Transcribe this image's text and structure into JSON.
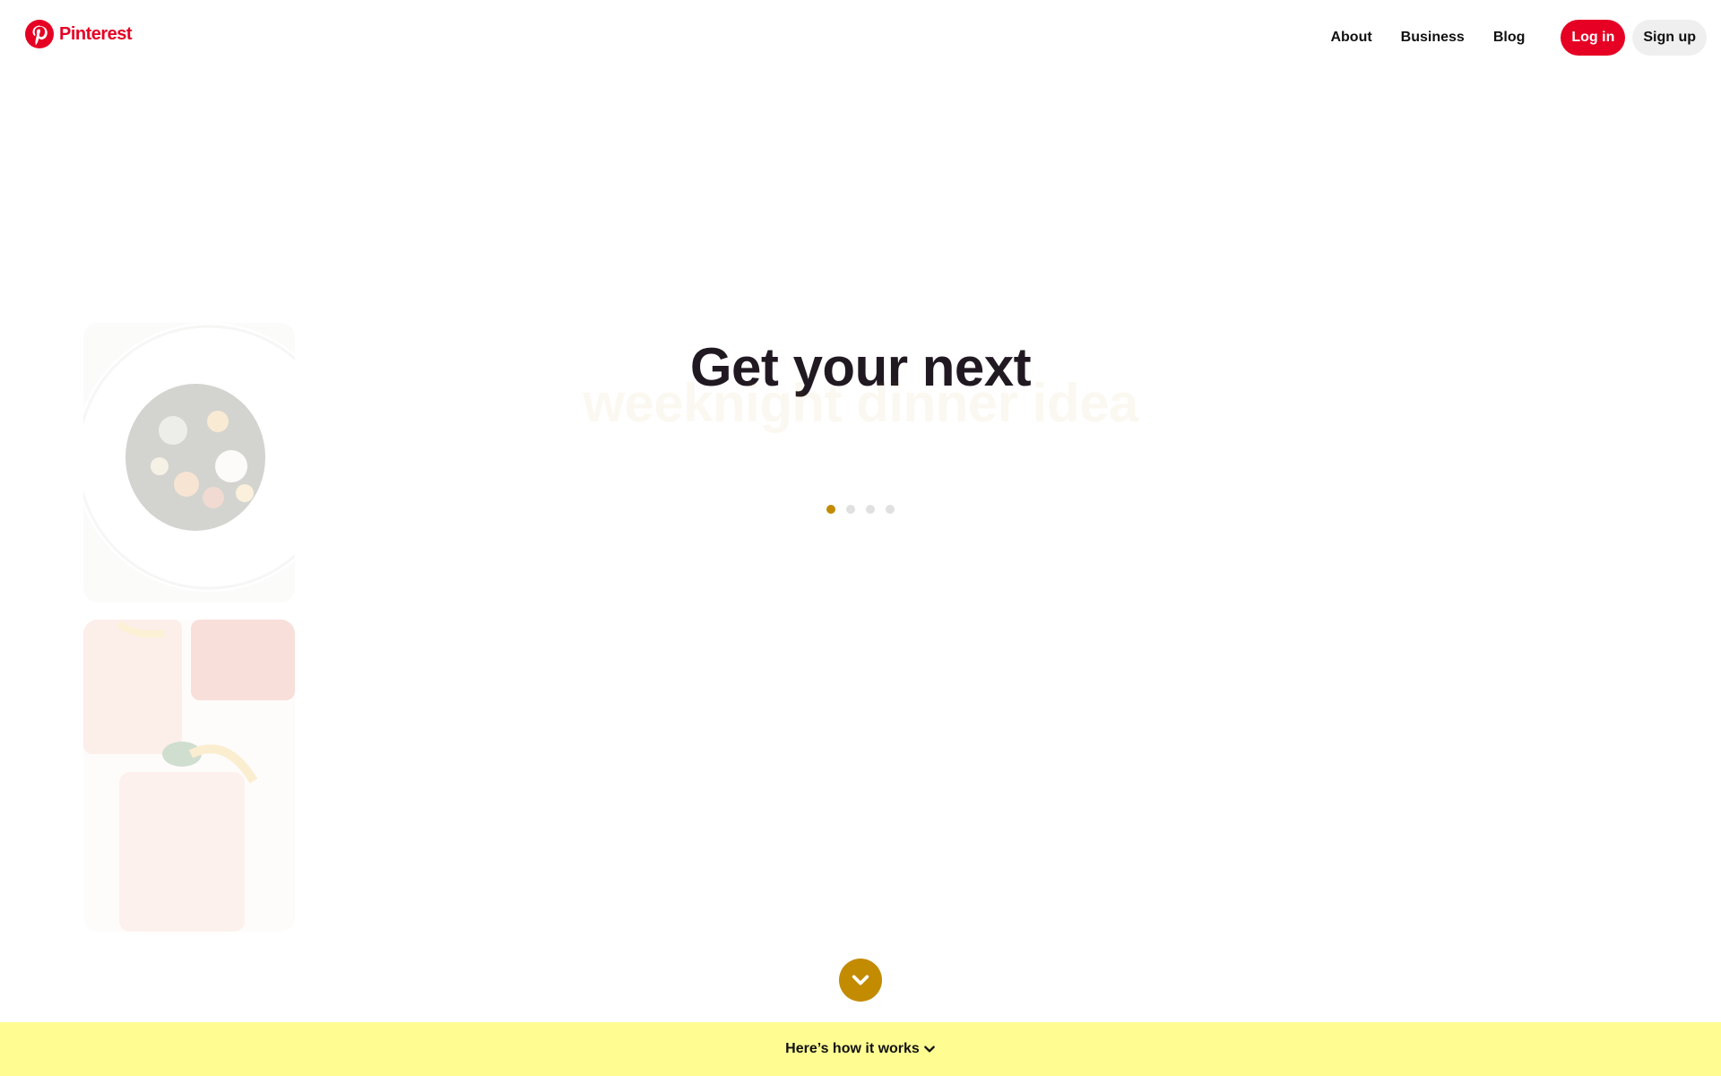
{
  "header": {
    "brand": "Pinterest",
    "nav": {
      "about": "About",
      "business": "Business",
      "blog": "Blog"
    },
    "login_label": "Log in",
    "signup_label": "Sign up"
  },
  "hero": {
    "title": "Get your next",
    "subtitle": "weeknight dinner idea"
  },
  "carousel": {
    "dot_count": 4,
    "active_index": 0
  },
  "footer": {
    "how_it_works": "Here’s how it works"
  },
  "colors": {
    "brand_red": "#e60023",
    "accent_gold": "#c28b00",
    "footer_yellow": "#fffd92",
    "title_dark": "#211922",
    "signup_bg": "#efefef"
  }
}
